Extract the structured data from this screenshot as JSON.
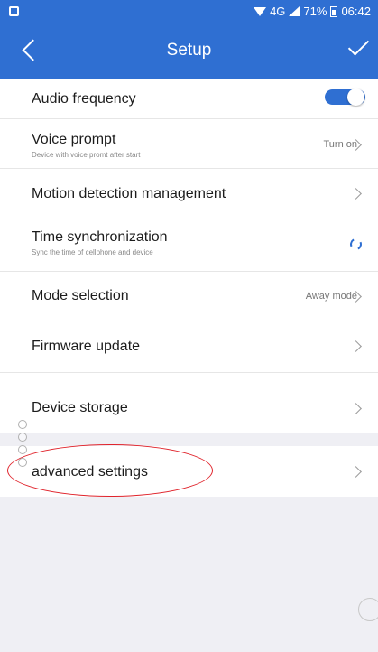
{
  "status_bar": {
    "network": "4G",
    "battery": "71%",
    "time": "06:42"
  },
  "header": {
    "title": "Setup"
  },
  "settings": {
    "audio_frequency": {
      "label": "Audio frequency",
      "enabled": true
    },
    "voice_prompt": {
      "label": "Voice prompt",
      "subtitle": "Device with voice promt after start",
      "value": "Turn on"
    },
    "motion_detection": {
      "label": "Motion detection management"
    },
    "time_sync": {
      "label": "Time synchronization",
      "subtitle": "Sync the time of cellphone and device"
    },
    "mode_selection": {
      "label": "Mode selection",
      "value": "Away mode"
    },
    "firmware_update": {
      "label": "Firmware update"
    },
    "device_storage": {
      "label": "Device storage"
    },
    "advanced_settings": {
      "label": "advanced settings"
    }
  },
  "colors": {
    "primary": "#2f6fd2",
    "annotation": "#e0242c"
  }
}
